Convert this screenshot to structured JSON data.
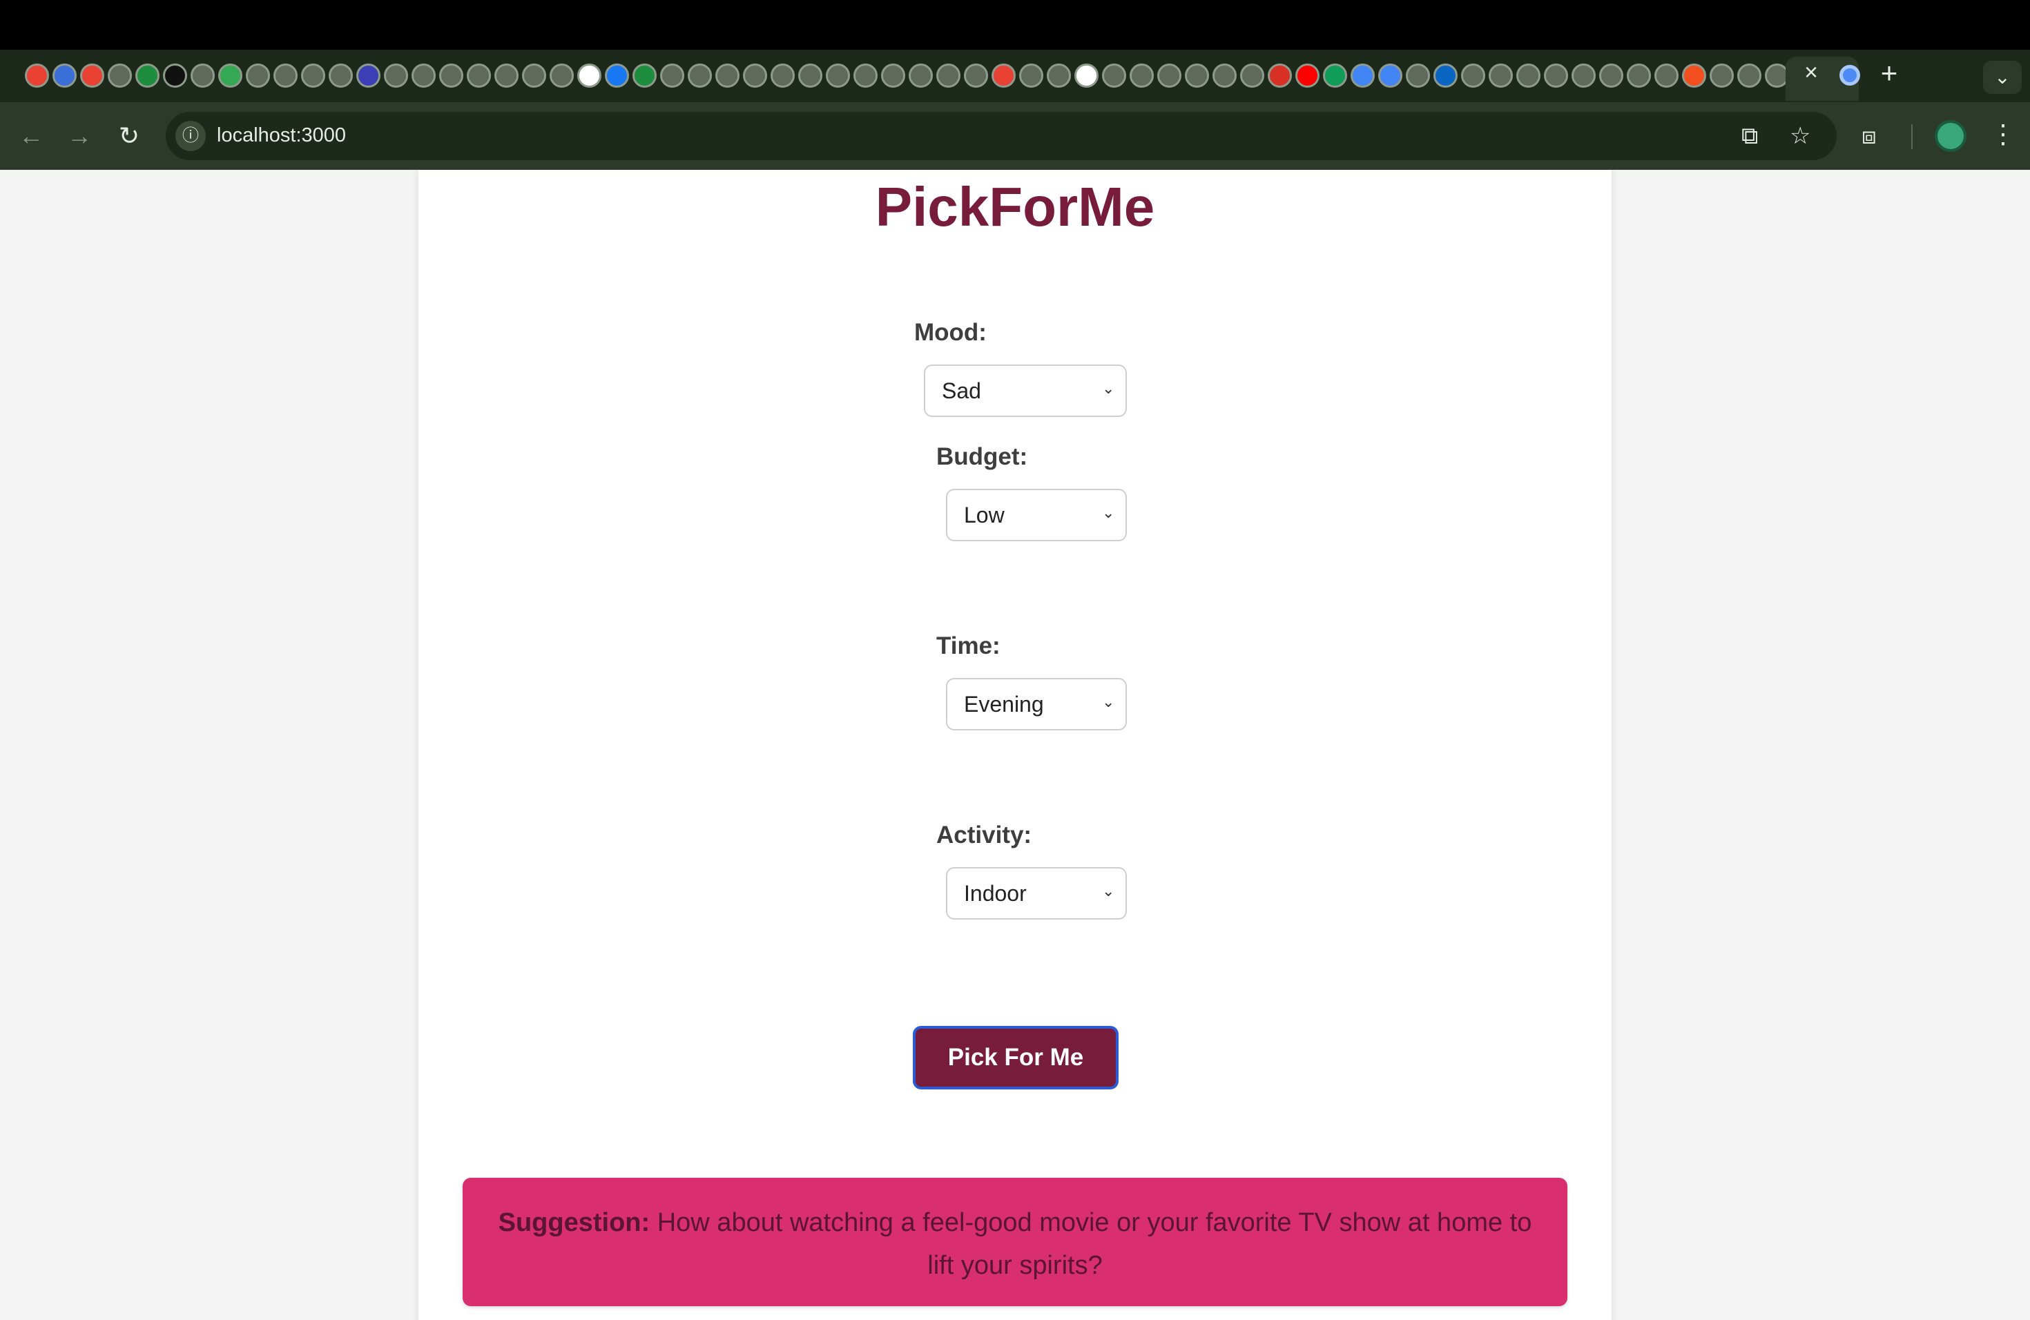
{
  "browser": {
    "url": "localhost:3000",
    "tab_close_label": "×",
    "new_tab_label": "+",
    "tab_menu_label": "⌄",
    "nav_back_label": "←",
    "nav_forward_label": "→",
    "nav_reload_label": "↻",
    "site_info_label": "ⓘ",
    "install_label": "⧉",
    "star_label": "☆",
    "extensions_label": "⧈",
    "menu_label": "⋮",
    "favicons": [
      "gmail-icon",
      "r-icon",
      "gmail-icon",
      "globe-icon",
      "g-icon",
      "github-icon",
      "globe-icon",
      "refresh-icon",
      "globe-icon",
      "globe-icon",
      "globe-icon",
      "globe-icon",
      "a-icon",
      "globe-icon",
      "globe-icon",
      "globe-icon",
      "globe-icon",
      "globe-icon",
      "globe-icon",
      "globe-icon",
      "openai-icon",
      "meta-icon",
      "g-icon",
      "globe-icon",
      "globe-icon",
      "globe-icon",
      "globe-icon",
      "globe-icon",
      "globe-icon",
      "globe-icon",
      "globe-icon",
      "globe-icon",
      "globe-icon",
      "globe-icon",
      "globe-icon",
      "gmail-icon",
      "globe-icon",
      "globe-icon",
      "openai-icon",
      "globe-icon",
      "globe-icon",
      "globe-icon",
      "globe-icon",
      "globe-icon",
      "globe-icon",
      "pdf-icon",
      "youtube-icon",
      "sheets-icon",
      "docs-icon",
      "docs-icon",
      "globe-icon",
      "linkedin-icon",
      "globe-icon",
      "globe-icon",
      "globe-icon",
      "globe-icon",
      "globe-icon",
      "globe-icon",
      "globe-icon",
      "globe-icon",
      "figma-icon",
      "globe-icon",
      "globe-icon",
      "globe-icon",
      "youtube-icon",
      "square-icon"
    ],
    "colors": {
      "frame": "#2c3b29",
      "tabstrip": "#1d2a1b"
    }
  },
  "app": {
    "title": "PickForMe",
    "fields": {
      "mood": {
        "label": "Mood:",
        "value": "Sad"
      },
      "budget": {
        "label": "Budget:",
        "value": "Low"
      },
      "time": {
        "label": "Time:",
        "value": "Evening"
      },
      "activity": {
        "label": "Activity:",
        "value": "Indoor"
      }
    },
    "submit_label": "Pick For Me",
    "suggestion": {
      "label": "Suggestion:",
      "text": " How about watching a feel-good movie or your favorite TV show at home to lift your spirits?"
    },
    "colors": {
      "brand": "#781c3c",
      "suggestion_bg": "#d92f6f"
    }
  }
}
